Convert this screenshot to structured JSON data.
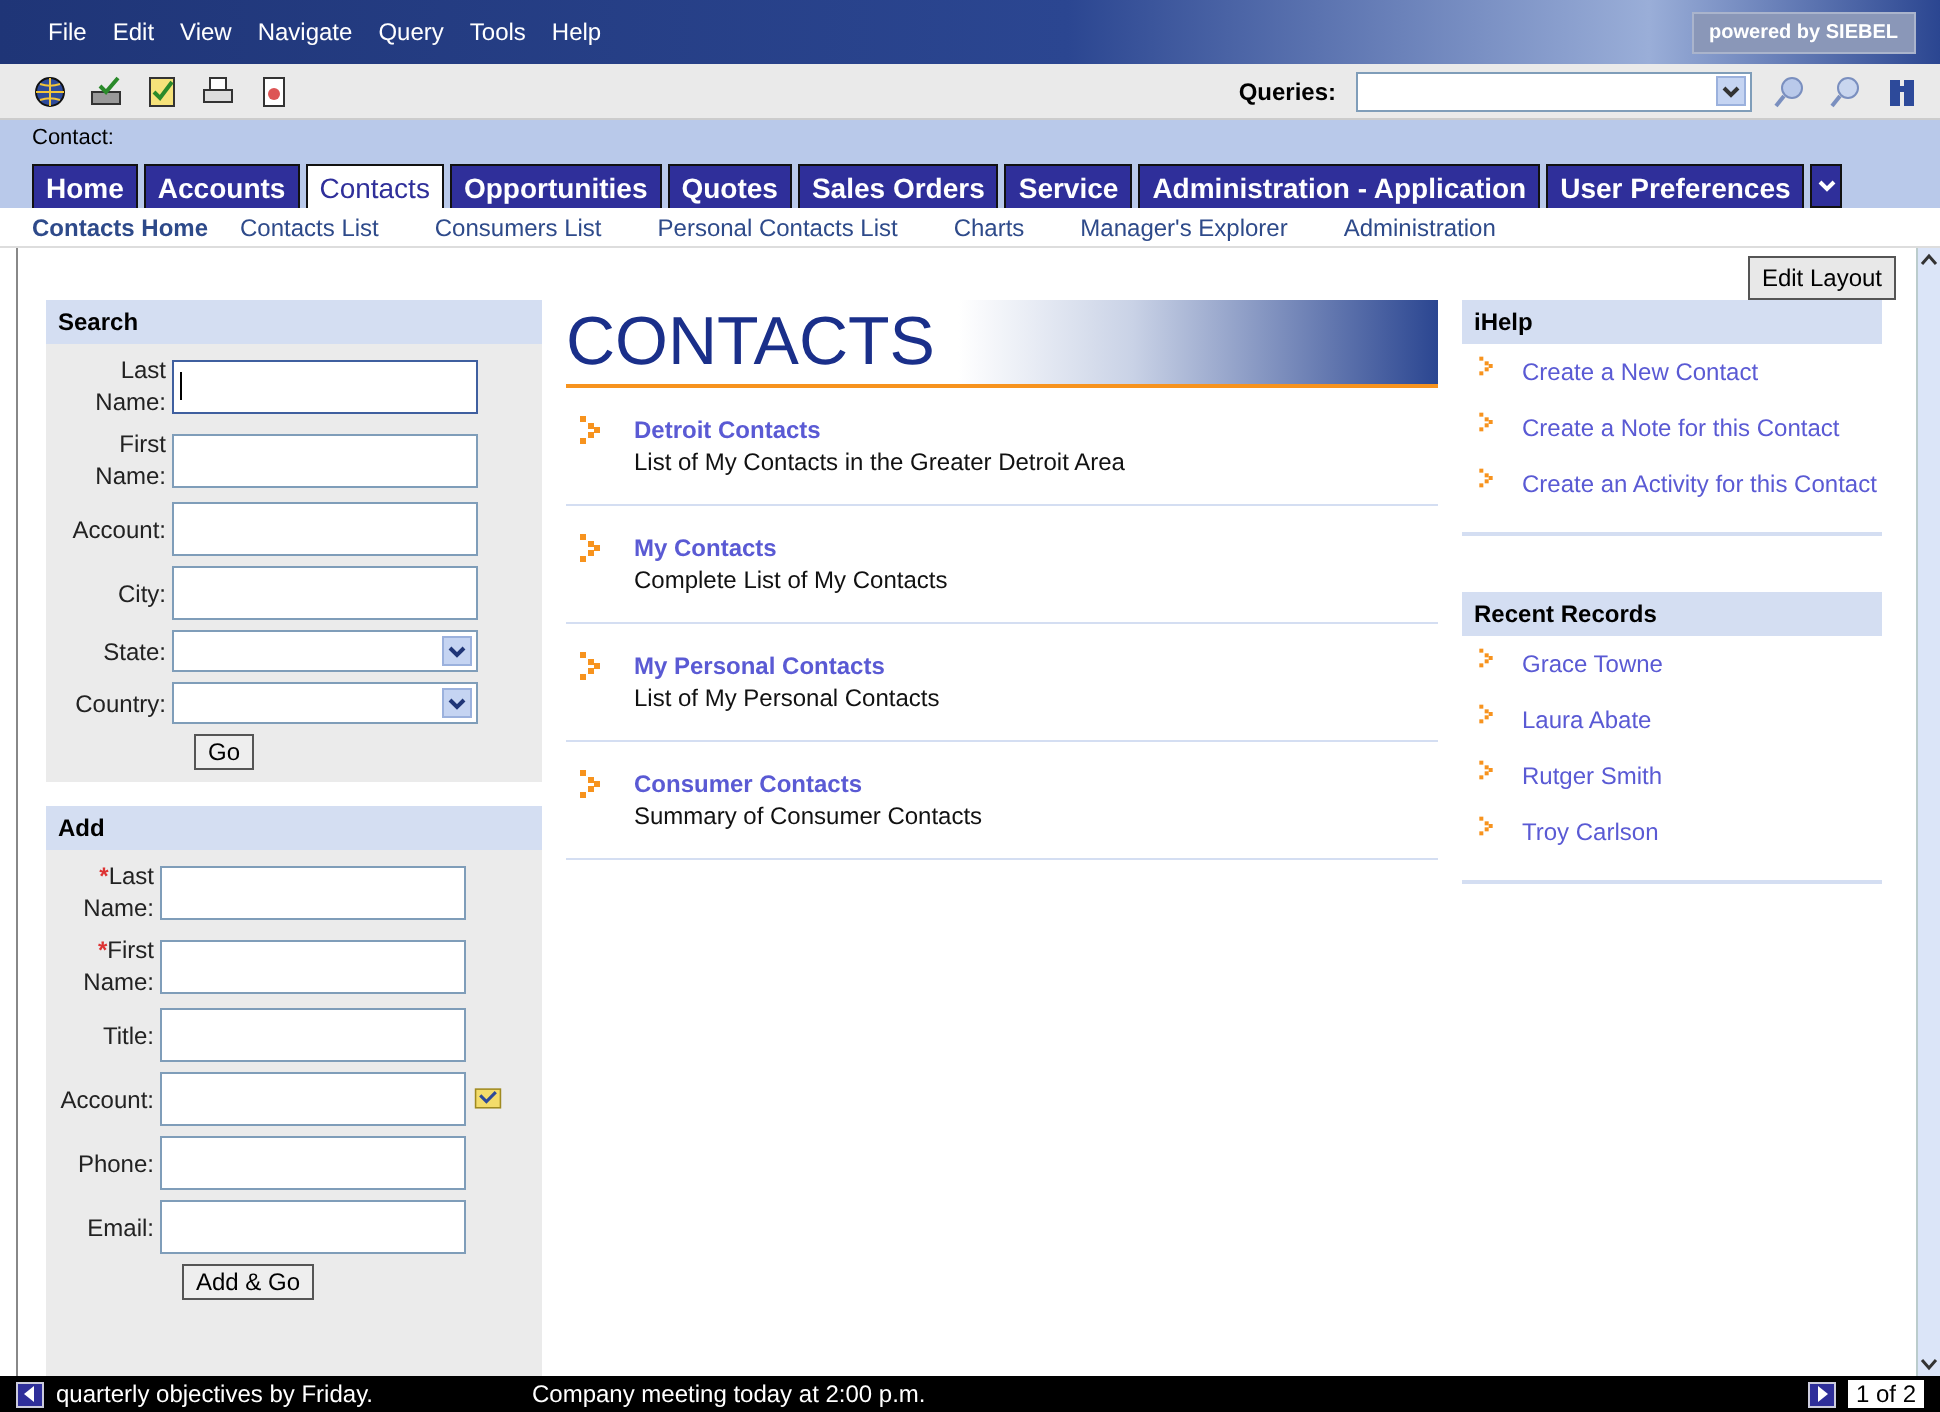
{
  "menu_bar": {
    "items": [
      "File",
      "Edit",
      "View",
      "Navigate",
      "Query",
      "Tools",
      "Help"
    ],
    "brand": "powered by SIEBEL"
  },
  "toolbar": {
    "queries_label": "Queries:"
  },
  "context_label": "Contact:",
  "tabs": [
    {
      "label": "Home",
      "selected": false
    },
    {
      "label": "Accounts",
      "selected": false
    },
    {
      "label": "Contacts",
      "selected": true
    },
    {
      "label": "Opportunities",
      "selected": false
    },
    {
      "label": "Quotes",
      "selected": false
    },
    {
      "label": "Sales Orders",
      "selected": false
    },
    {
      "label": "Service",
      "selected": false
    },
    {
      "label": "Administration - Application",
      "selected": false
    },
    {
      "label": "User Preferences",
      "selected": false
    }
  ],
  "sub_tabs": [
    {
      "label": "Contacts Home",
      "selected": true
    },
    {
      "label": "Contacts List",
      "selected": false
    },
    {
      "label": "Consumers List",
      "selected": false
    },
    {
      "label": "Personal Contacts List",
      "selected": false
    },
    {
      "label": "Charts",
      "selected": false
    },
    {
      "label": "Manager's Explorer",
      "selected": false
    },
    {
      "label": "Administration",
      "selected": false
    }
  ],
  "edit_layout_button": "Edit Layout",
  "search_panel": {
    "title": "Search",
    "fields": [
      {
        "label": "Last Name:",
        "kind": "text",
        "focused": true
      },
      {
        "label": "First Name:",
        "kind": "text",
        "focused": false
      },
      {
        "label": "Account:",
        "kind": "text",
        "focused": false
      },
      {
        "label": "City:",
        "kind": "text",
        "focused": false
      },
      {
        "label": "State:",
        "kind": "select",
        "focused": false
      },
      {
        "label": "Country:",
        "kind": "select",
        "focused": false
      }
    ],
    "button": "Go"
  },
  "add_panel": {
    "title": "Add",
    "required_marker": "*",
    "fields": [
      {
        "label": "Last Name:",
        "kind": "text",
        "required": true
      },
      {
        "label": "First Name:",
        "kind": "text",
        "required": true
      },
      {
        "label": "Title:",
        "kind": "text",
        "required": false
      },
      {
        "label": "Account:",
        "kind": "picker",
        "required": false
      },
      {
        "label": "Phone:",
        "kind": "text",
        "required": false
      },
      {
        "label": "Email:",
        "kind": "text",
        "required": false
      }
    ],
    "button": "Add & Go"
  },
  "main": {
    "title": "CONTACTS",
    "items": [
      {
        "title": "Detroit Contacts",
        "description": "List of My Contacts in the Greater Detroit Area"
      },
      {
        "title": "My Contacts",
        "description": "Complete List of My Contacts"
      },
      {
        "title": "My Personal Contacts",
        "description": "List of My Personal Contacts"
      },
      {
        "title": "Consumer Contacts",
        "description": "Summary of Consumer Contacts"
      }
    ]
  },
  "ihelp": {
    "title": "iHelp",
    "items": [
      "Create a New Contact",
      "Create a Note for this Contact",
      "Create an Activity for this Contact"
    ]
  },
  "recent_records": {
    "title": "Recent Records",
    "items": [
      "Grace Towne",
      "Laura Abate",
      "Rutger Smith",
      "Troy Carlson"
    ]
  },
  "status_bar": {
    "messages": [
      "quarterly objectives by Friday.",
      "Company meeting today at 2:00 p.m."
    ],
    "page": "1 of 2"
  }
}
